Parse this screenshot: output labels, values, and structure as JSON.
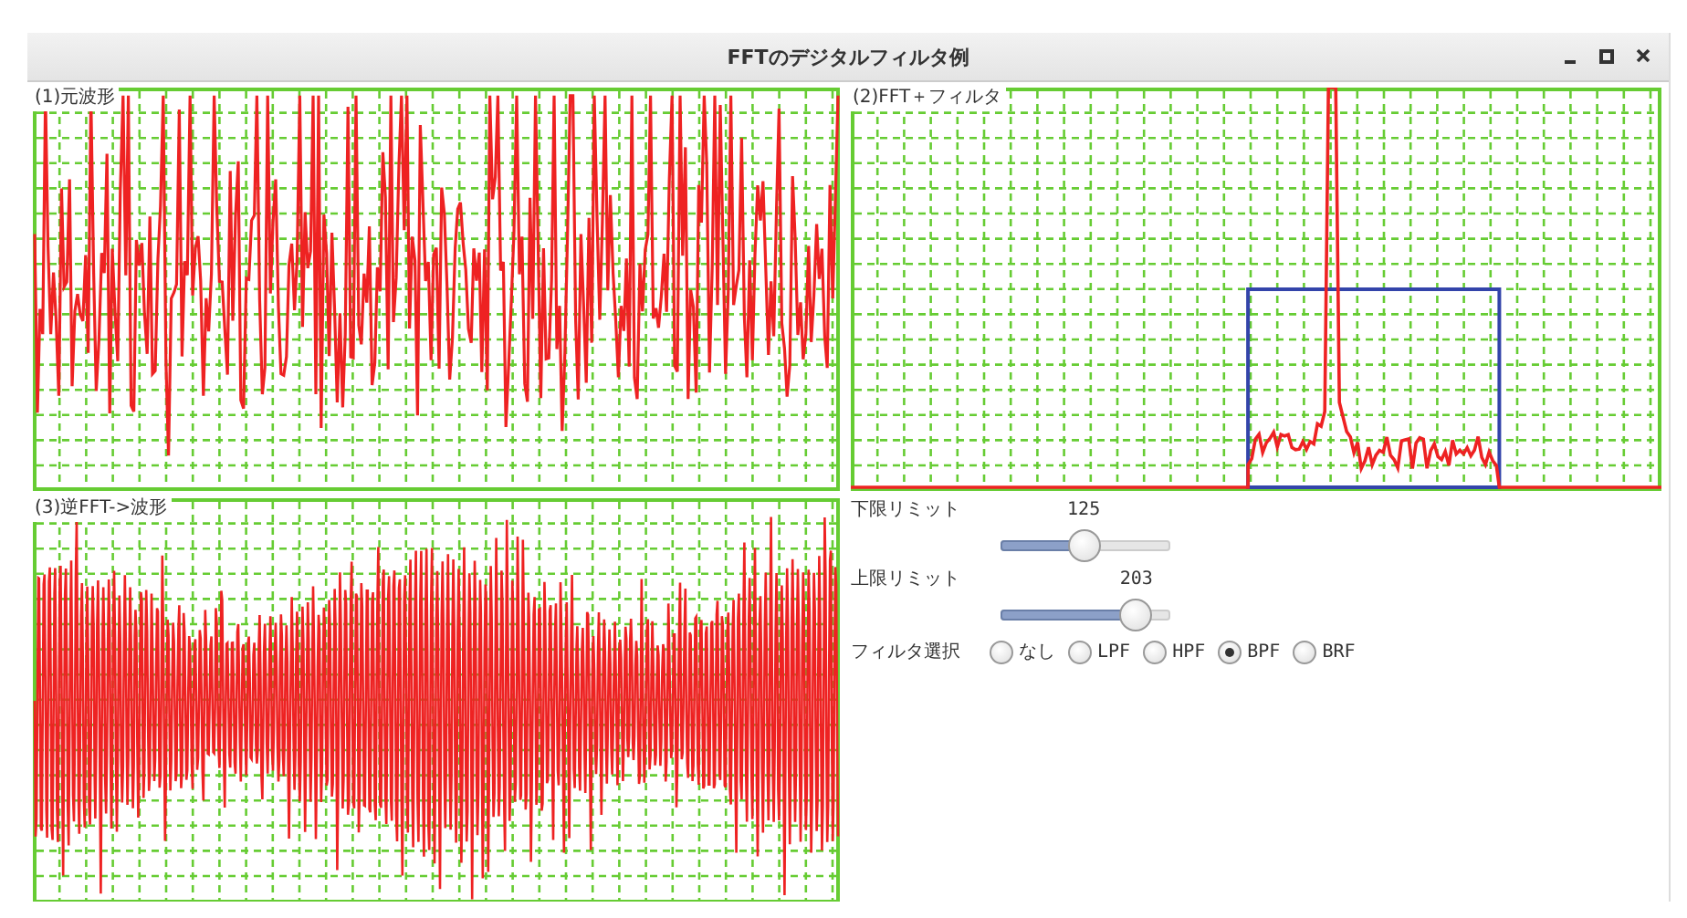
{
  "window": {
    "title": "FFTのデジタルフィルタ例"
  },
  "charts": [
    {
      "title": "(1)元波形",
      "kind": "waveform"
    },
    {
      "title": "(2)FFT＋フィルタ",
      "kind": "spectrum"
    },
    {
      "title": "(3)逆FFT->波形",
      "kind": "dense"
    }
  ],
  "sliders": [
    {
      "label": "下限リミット",
      "reading": "125",
      "level": 0.49
    },
    {
      "label": "上限リミット",
      "reading": "203",
      "level": 0.8
    }
  ],
  "filter": {
    "label": "フィルタ選択",
    "options": [
      {
        "label": "なし",
        "selected": false
      },
      {
        "label": "LPF",
        "selected": false
      },
      {
        "label": "HPF",
        "selected": false
      },
      {
        "label": "BPF",
        "selected": true
      },
      {
        "label": "BRF",
        "selected": false
      }
    ]
  }
}
